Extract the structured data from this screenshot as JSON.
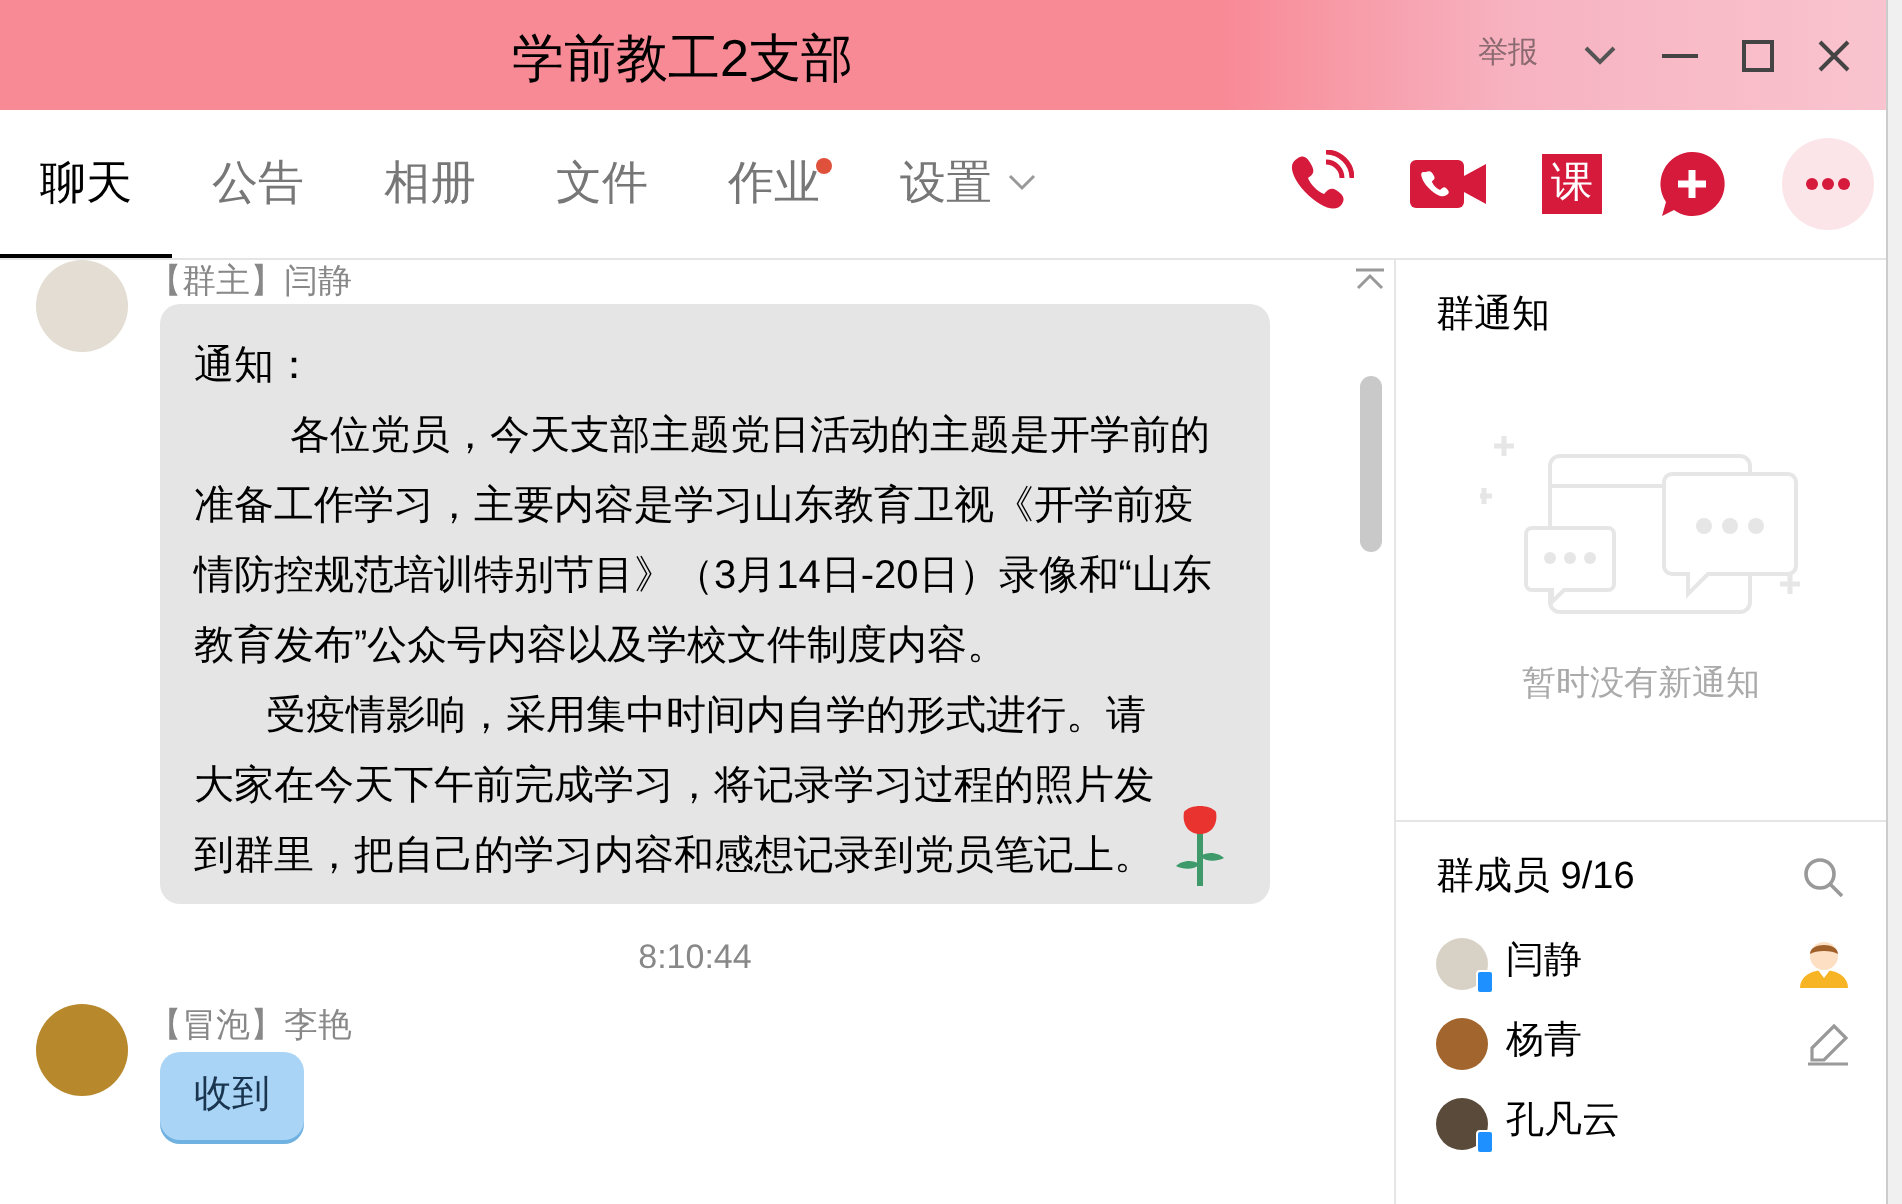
{
  "window": {
    "title": "学前教工2支部",
    "report": "举报"
  },
  "tabs": [
    {
      "label": "聊天",
      "selected": true,
      "dot": false,
      "dropdown": false
    },
    {
      "label": "公告",
      "selected": false,
      "dot": false,
      "dropdown": false
    },
    {
      "label": "相册",
      "selected": false,
      "dot": false,
      "dropdown": false
    },
    {
      "label": "文件",
      "selected": false,
      "dot": false,
      "dropdown": false
    },
    {
      "label": "作业",
      "selected": false,
      "dot": true,
      "dropdown": false
    },
    {
      "label": "设置",
      "selected": false,
      "dot": false,
      "dropdown": true
    }
  ],
  "toolbar": {
    "lesson_button": "课"
  },
  "messages": [
    {
      "sender": "【群主】闫静",
      "kind": "notice",
      "paragraphs": [
        "通知：",
        "各位党员，今天支部主题党日活动的主题是开学前的准备工作学习，主要内容是学习山东教育卫视《开学前疫情防控规范培训特别节目》（3月14日-20日）录像和“山东教育发布”公众号内容以及学校文件制度内容。",
        "受疫情影响，采用集中时间内自学的形式进行。请大家在今天下午前完成学习，将记录学习过程的照片发到群里，把自己的学习内容和感想记录到党员笔记上。"
      ]
    },
    {
      "time": "8:10:44",
      "sender": "【冒泡】李艳",
      "kind": "bubble",
      "paragraphs": [
        "收到"
      ]
    }
  ],
  "group_notice": {
    "title": "群通知",
    "empty_text": "暂时没有新通知"
  },
  "members": {
    "title": "群成员 9/16",
    "list": [
      {
        "name": "闫静",
        "mobile": true,
        "kind": "owner"
      },
      {
        "name": "杨青",
        "mobile": false,
        "kind": "admin"
      },
      {
        "name": "孔凡云",
        "mobile": true,
        "kind": "member"
      }
    ]
  }
}
